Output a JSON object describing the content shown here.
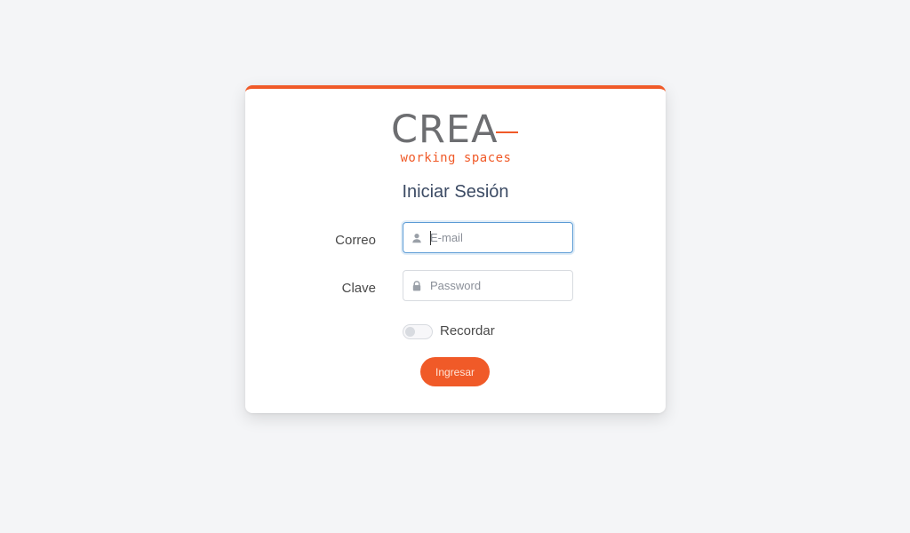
{
  "brand": {
    "name": "CREA",
    "tagline": "working spaces",
    "accent_color": "#f05a28",
    "text_color": "#6d6e71"
  },
  "login": {
    "title": "Iniciar Sesión",
    "email_label": "Correo",
    "email_placeholder": "E-mail",
    "email_value": "",
    "email_icon": "user-icon",
    "password_label": "Clave",
    "password_placeholder": "Password",
    "password_value": "",
    "password_icon": "lock-icon",
    "remember_label": "Recordar",
    "remember_checked": false,
    "submit_label": "Ingresar"
  }
}
